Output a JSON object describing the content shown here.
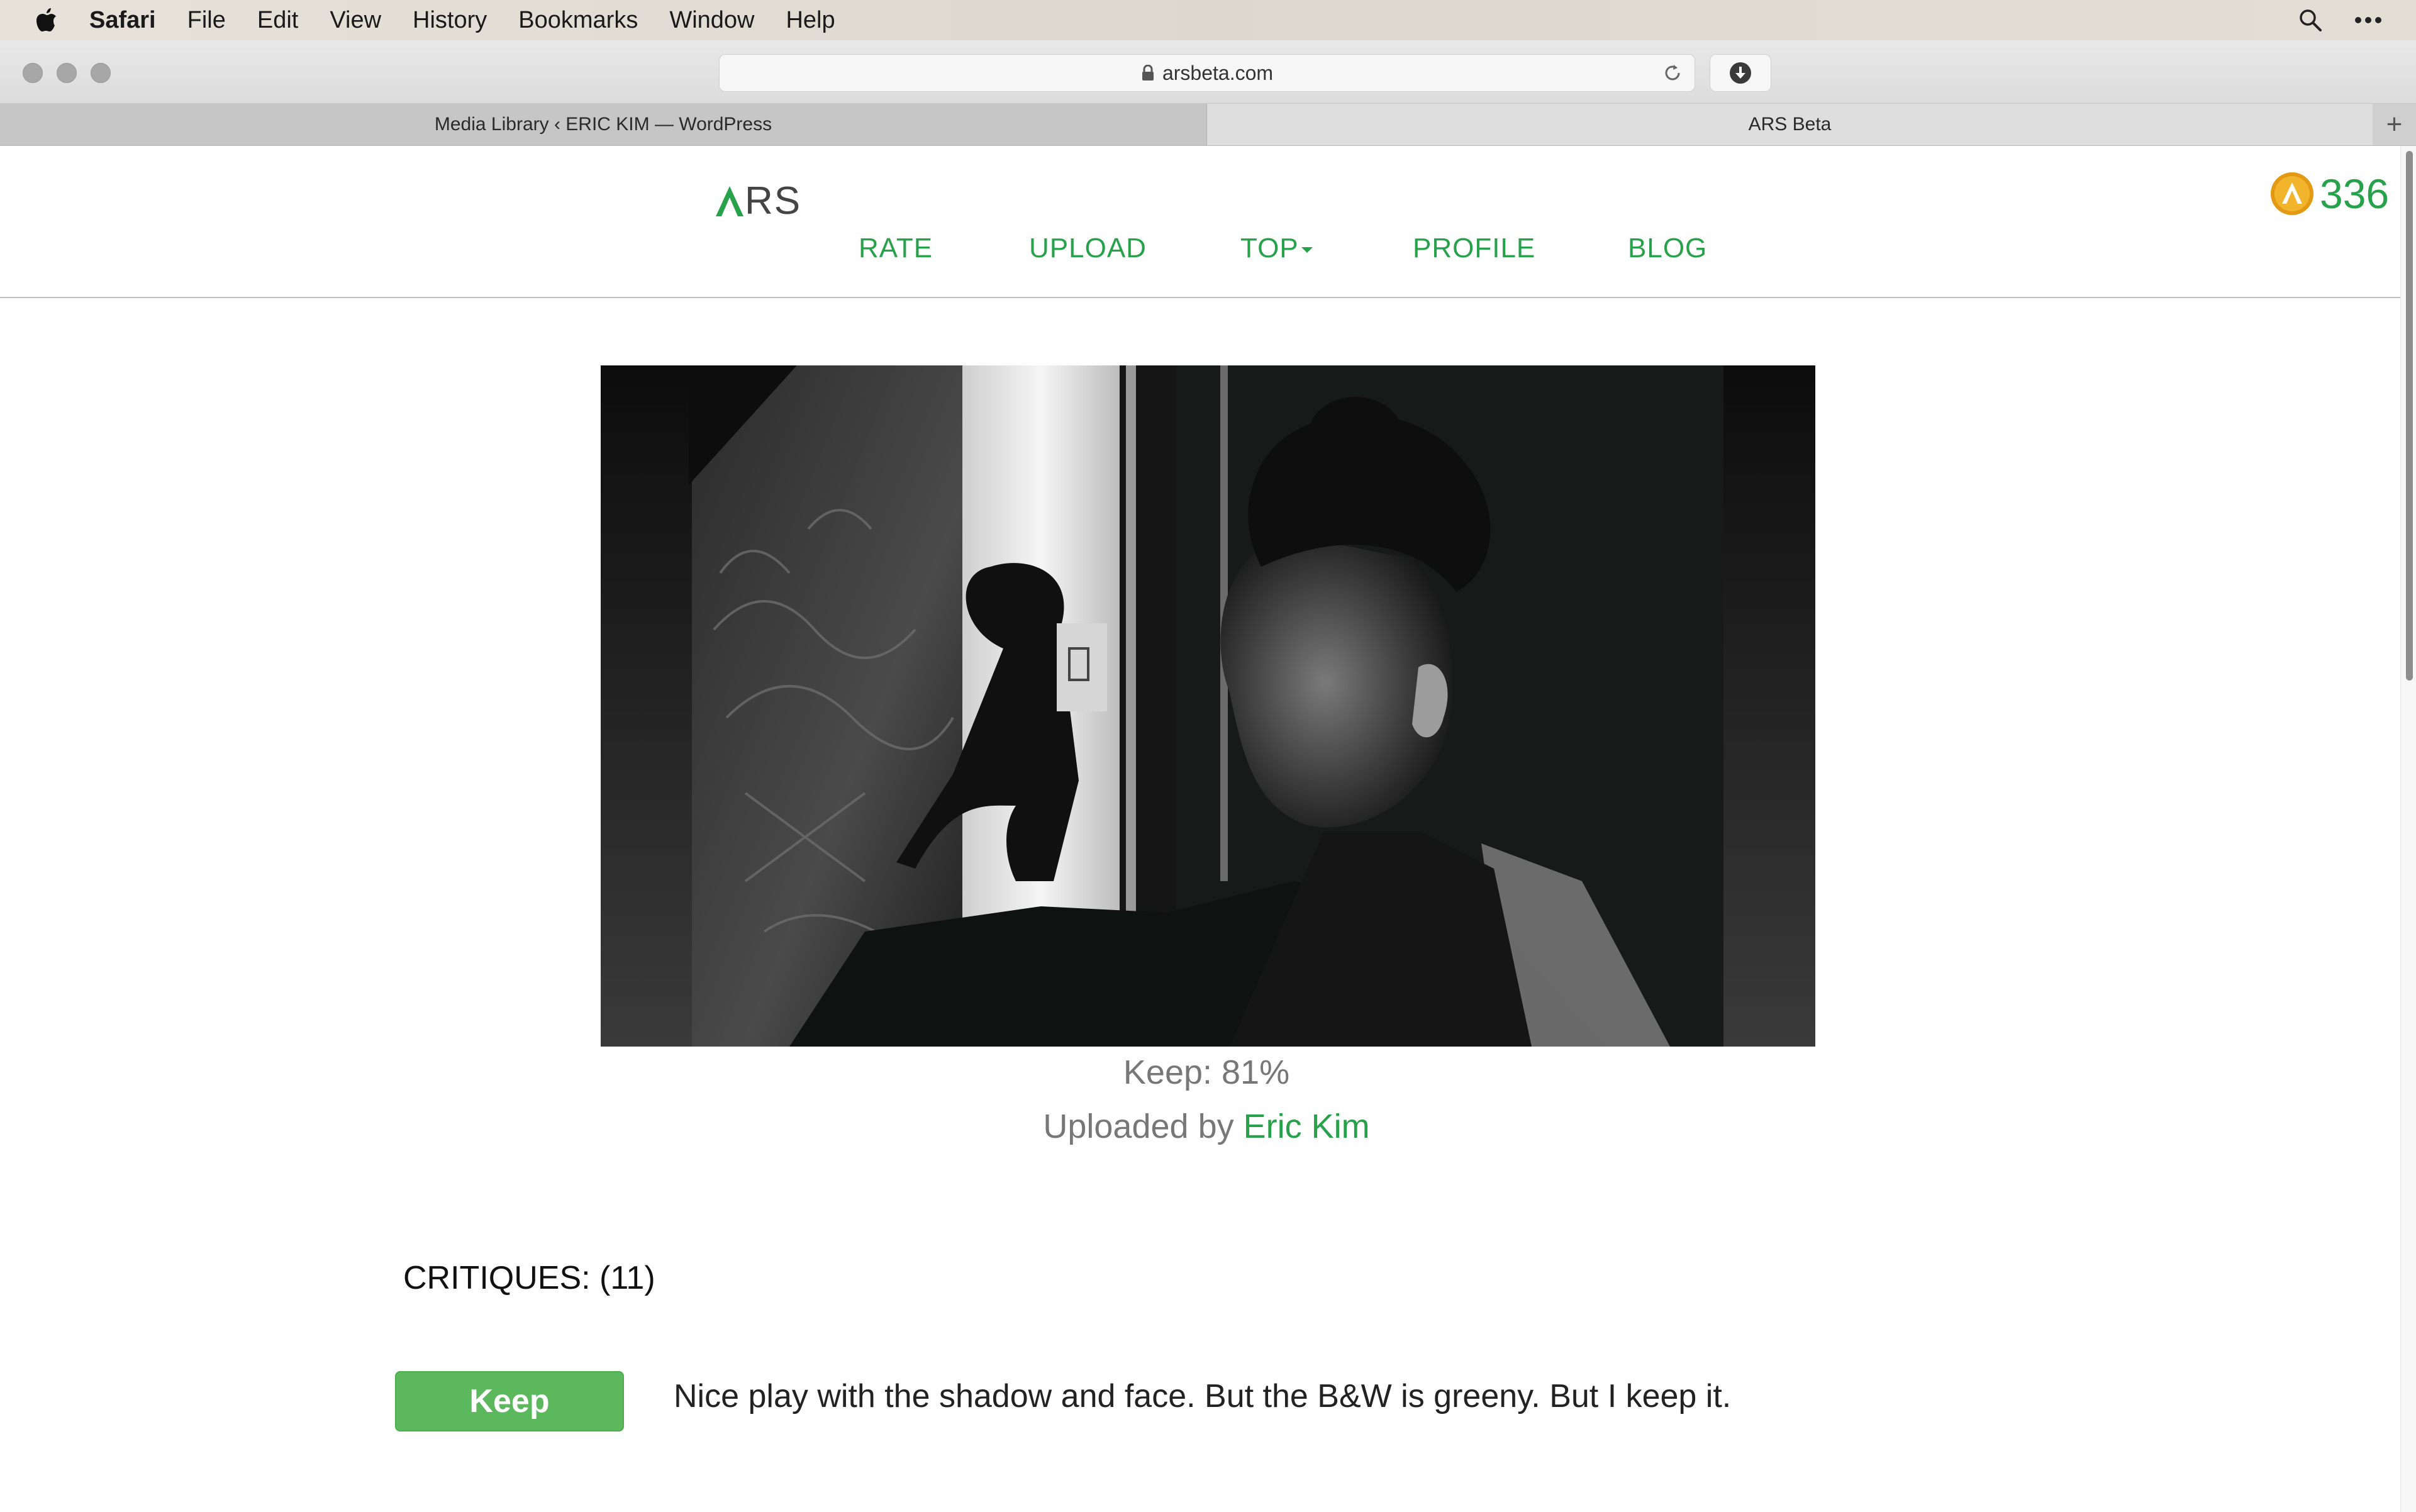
{
  "menubar": {
    "app": "Safari",
    "items": [
      "File",
      "Edit",
      "View",
      "History",
      "Bookmarks",
      "Window",
      "Help"
    ]
  },
  "toolbar": {
    "url": "arsbeta.com"
  },
  "tabs": [
    {
      "title": "Media Library ‹ ERIC KIM — WordPress",
      "active": false
    },
    {
      "title": "ARS Beta",
      "active": true
    }
  ],
  "newtab_label": "+",
  "site": {
    "logo_text": "RS",
    "nav": {
      "rate": "RATE",
      "upload": "UPLOAD",
      "top": "TOP",
      "profile": "PROFILE",
      "blog": "BLOG"
    },
    "points": "336",
    "accent_color": "#27a14a"
  },
  "photo": {
    "keep_label": "Keep: 81%",
    "keep_fraction": 0.81,
    "uploaded_prefix": "Uploaded by",
    "author": "Eric Kim"
  },
  "critiques": {
    "title": "CRITIQUES: (11)",
    "items": [
      {
        "verdict": "Keep",
        "text": "Nice play with the shadow and face. But the B&W is greeny. But I keep it."
      }
    ]
  }
}
